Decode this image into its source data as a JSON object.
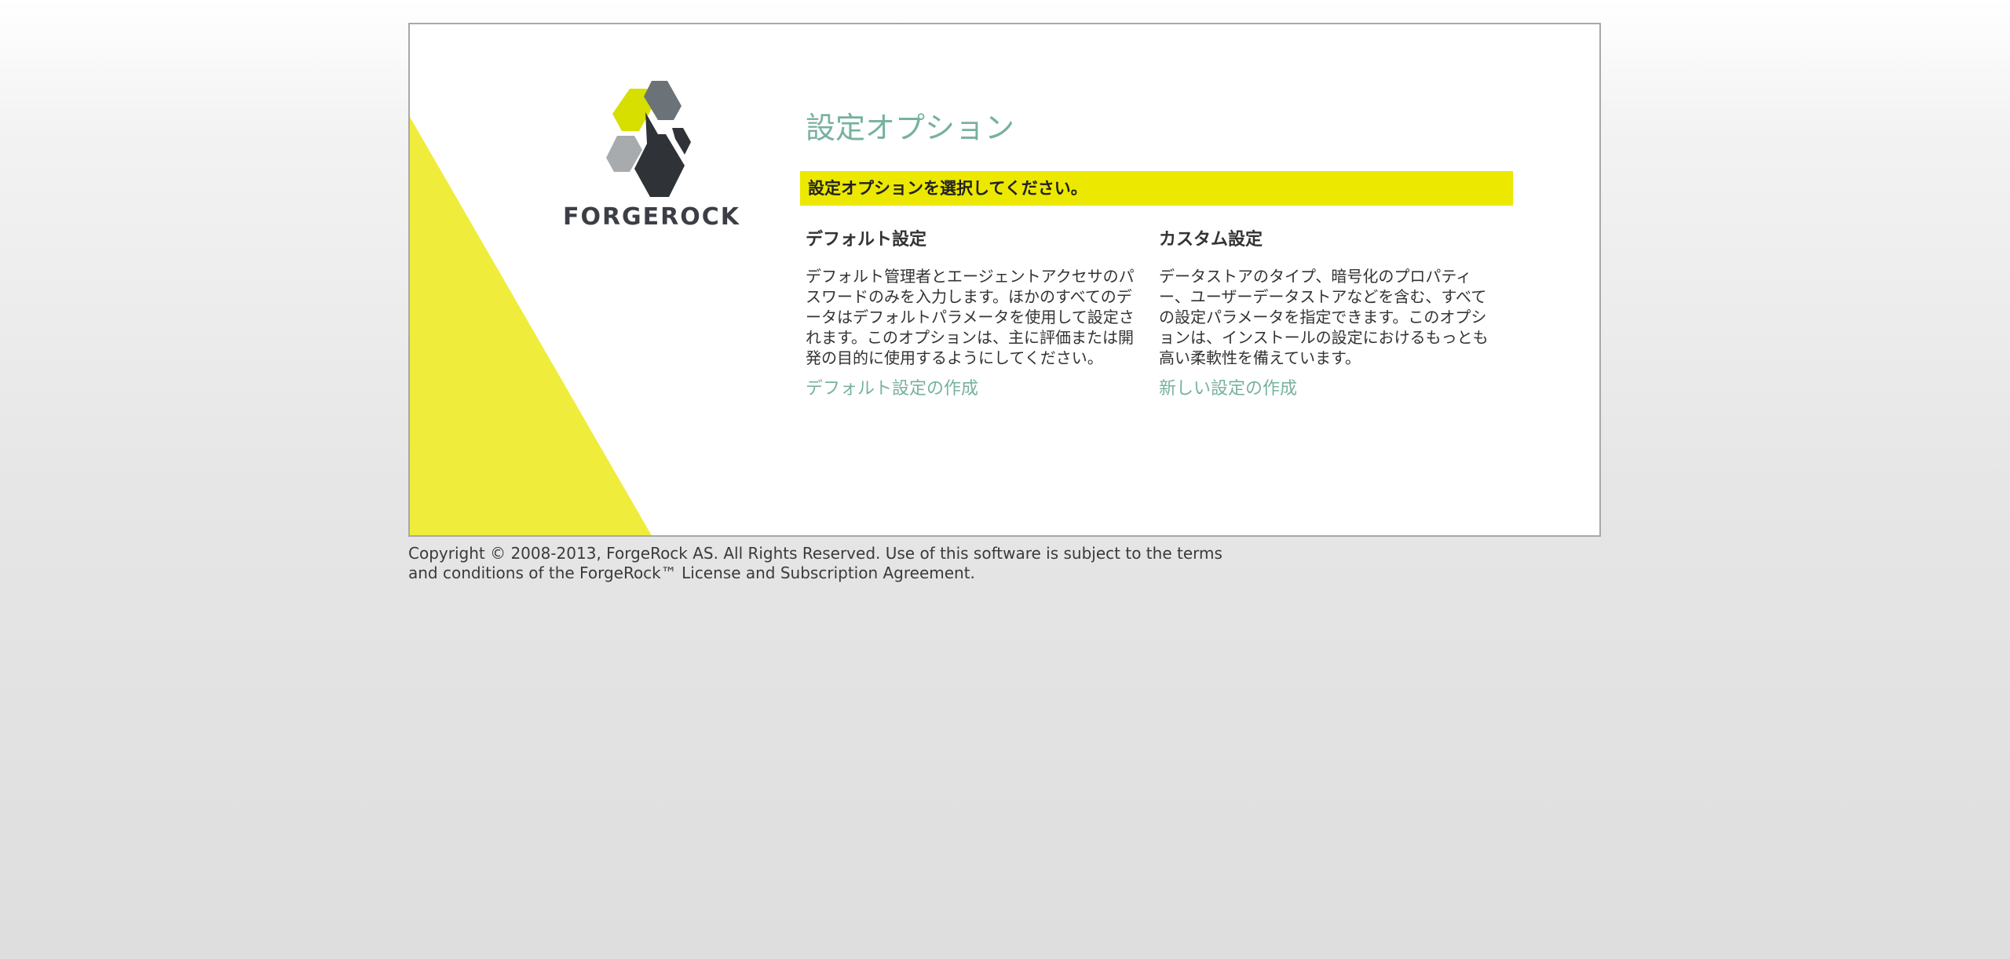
{
  "brand": {
    "logo_text": "FORGEROCK",
    "accent_yellow": "#ece800",
    "triangle_yellow": "#efec3c",
    "link_color": "#77b1a0"
  },
  "main": {
    "title": "設定オプション",
    "banner": "設定オプションを選択してください。",
    "options": [
      {
        "heading": "デフォルト設定",
        "description": "デフォルト管理者とエージェントアクセサのパスワードのみを入力します。ほかのすべてのデータはデフォルトパラメータを使用して設定されます。このオプションは、主に評価または開発の目的に使用するようにしてください。",
        "link": "デフォルト設定の作成"
      },
      {
        "heading": "カスタム設定",
        "description": "データストアのタイプ、暗号化のプロパティー、ユーザーデータストアなどを含む、すべての設定パラメータを指定できます。このオプションは、インストールの設定におけるもっとも高い柔軟性を備えています。",
        "link": "新しい設定の作成"
      }
    ]
  },
  "footer": {
    "line1": "Copyright © 2008-2013, ForgeRock AS. All Rights Reserved. Use of this software is subject to the terms",
    "line2": "and conditions of the ForgeRock™ License and Subscription Agreement."
  }
}
